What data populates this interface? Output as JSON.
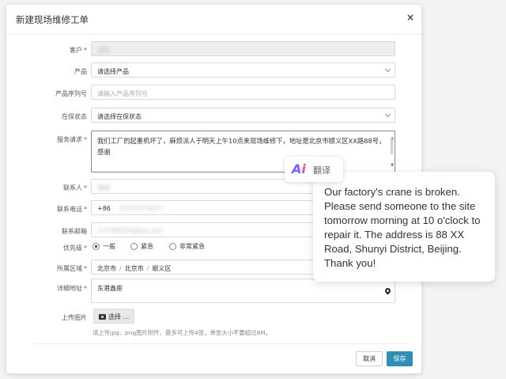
{
  "dialog": {
    "title": "新建现场维修工单",
    "close_glyph": "×"
  },
  "form": {
    "customer": {
      "label": "客户",
      "required": "*",
      "value": "湖南"
    },
    "product": {
      "label": "产品",
      "value": "请选择产品"
    },
    "serial": {
      "label": "产品序列号",
      "placeholder": "请输入产品序列号"
    },
    "warranty": {
      "label": "在保状态",
      "value": "请选择在保状态"
    },
    "service": {
      "label": "服务请求",
      "required": "*",
      "value": "我们工厂的起重机坏了，麻烦派人于明天上午10点来现场维修下，地址是北京市顺义区XX路88号，感谢"
    },
    "contact": {
      "label": "联系人",
      "required": "*",
      "value": "湖南"
    },
    "phone": {
      "label": "联系电话",
      "required": "*",
      "prefix": "+86",
      "value": "16222579623"
    },
    "email": {
      "label": "联系邮箱",
      "value": "125388103@qq.com"
    },
    "priority": {
      "label": "优先级",
      "required": "*",
      "options": [
        "一般",
        "紧急",
        "非常紧急"
      ],
      "selected": "一般"
    },
    "region": {
      "label": "所属区域",
      "required": "*",
      "parts": [
        "北京市",
        "北京市",
        "顺义区"
      ]
    },
    "address": {
      "label": "详细地址",
      "required": "*",
      "value": "东港鑫座"
    },
    "upload": {
      "label": "上传图片",
      "button": "选择 ...",
      "hint": "请上传jpg、png图片附件，最多可上传4张，单张大小不要超过8M。"
    }
  },
  "footer": {
    "cancel": "取消",
    "save": "保存"
  },
  "translate": {
    "badge_logo_a": "A",
    "badge_logo_i": "i",
    "badge_label": "翻译",
    "text": "Our factory's crane is broken. Please send someone to the site tomorrow morning at 10 o'clock to repair it. The address is 88 XX Road, Shunyi District, Beijing. Thank you!"
  },
  "colors": {
    "primary": "#2f8fb6",
    "required": "#e2322f",
    "ai_purple": "#7a5cff",
    "ai_pink": "#e34f9b"
  },
  "icons": [
    "close-icon",
    "chevron-down-icon",
    "map-pin-icon",
    "camera-icon",
    "ai-logo-icon"
  ]
}
